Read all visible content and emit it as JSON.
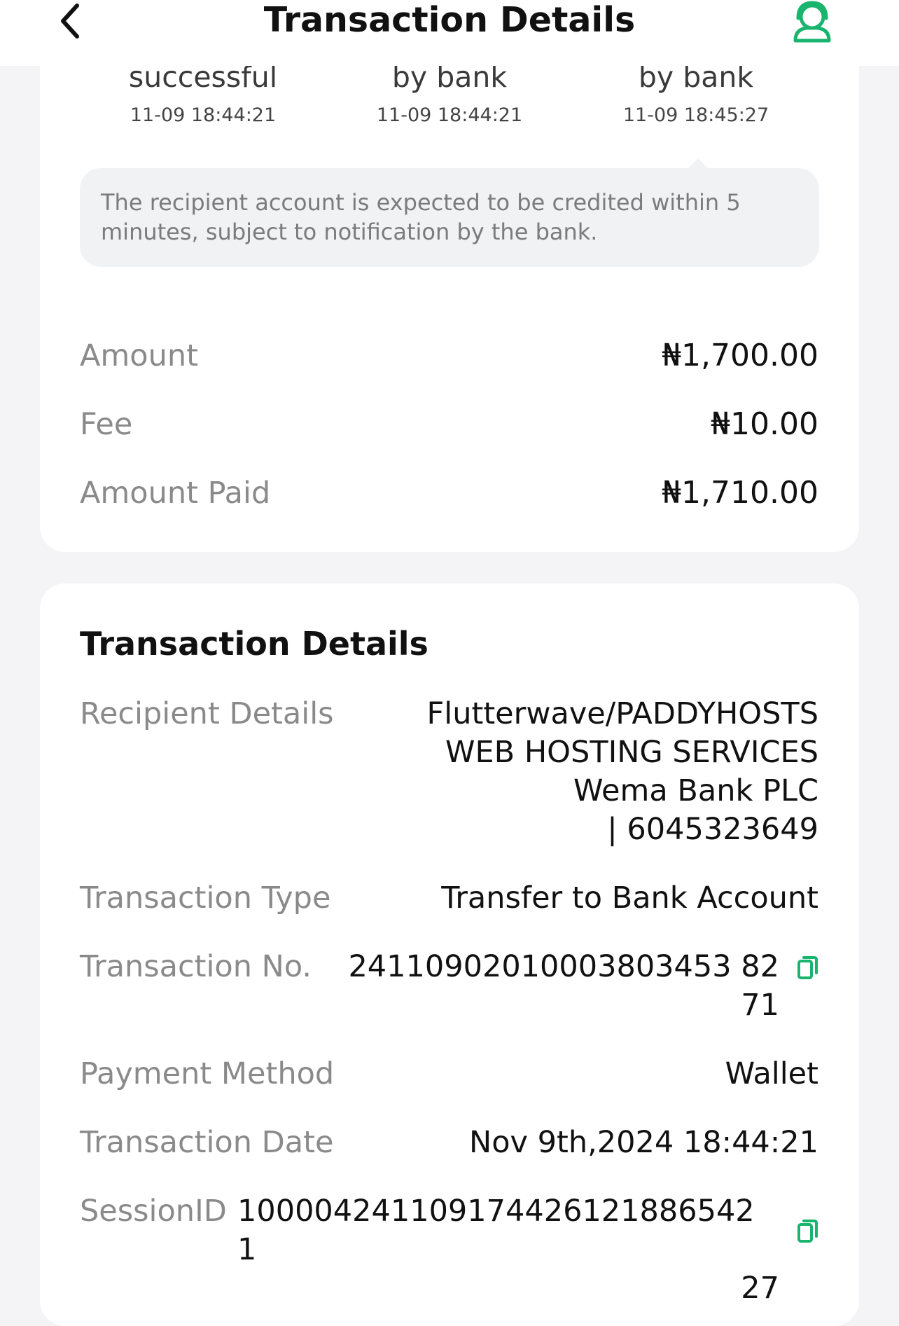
{
  "header": {
    "title": "Transaction Details",
    "back_icon": "chevron-left-icon",
    "support_icon": "customer-service-icon",
    "accent_color": "#19b46e"
  },
  "progress": {
    "steps": [
      {
        "status": "successful",
        "time": "11-09 18:44:21"
      },
      {
        "status": "by bank",
        "time": "11-09 18:44:21"
      },
      {
        "status": "by bank",
        "time": "11-09 18:45:27"
      }
    ],
    "note": "The recipient account is expected to be credited within 5 minutes, subject to notification by the bank."
  },
  "amounts": {
    "amount_label": "Amount",
    "amount_value": "₦1,700.00",
    "fee_label": "Fee",
    "fee_value": "₦10.00",
    "paid_label": "Amount Paid",
    "paid_value": "₦1,710.00"
  },
  "details": {
    "title": "Transaction Details",
    "recipient_label": "Recipient Details",
    "recipient_lines": [
      "Flutterwave/PADDYHOSTS",
      "WEB HOSTING SERVICES",
      "Wema Bank PLC",
      "| 6045323649"
    ],
    "type_label": "Transaction Type",
    "type_value": "Transfer to Bank Account",
    "number_label": "Transaction No.",
    "number_value_line1": "24110902010003803453 82",
    "number_value_line2": "71",
    "method_label": "Payment Method",
    "method_value": "Wallet",
    "date_label": "Transaction Date",
    "date_value": "Nov 9th,2024 18:44:21",
    "session_label": "SessionID",
    "session_value_line1": "100004241109174426121886542 1",
    "session_value_line2": "27",
    "copy_icon": "copy-icon"
  }
}
